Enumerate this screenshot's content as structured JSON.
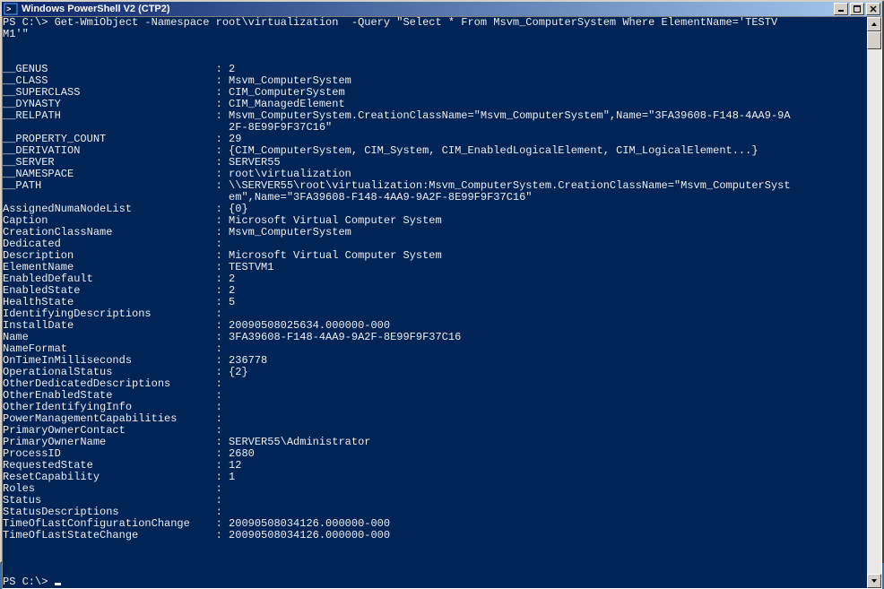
{
  "window": {
    "title": "Windows PowerShell V2 (CTP2)"
  },
  "console": {
    "prompt1": "PS C:\\> ",
    "command": "Get-WmiObject -Namespace root\\virtualization  -Query \"Select * From Msvm_ComputerSystem Where ElementName='TESTV",
    "command_line2": "M1'\"",
    "rows": [
      {
        "k": "__GENUS",
        "v": "2"
      },
      {
        "k": "__CLASS",
        "v": "Msvm_ComputerSystem"
      },
      {
        "k": "__SUPERCLASS",
        "v": "CIM_ComputerSystem"
      },
      {
        "k": "__DYNASTY",
        "v": "CIM_ManagedElement"
      },
      {
        "k": "__RELPATH",
        "v": "Msvm_ComputerSystem.CreationClassName=\"Msvm_ComputerSystem\",Name=\"3FA39608-F148-4AA9-9A"
      },
      {
        "k": "",
        "v": "2F-8E99F9F37C16\""
      },
      {
        "k": "__PROPERTY_COUNT",
        "v": "29"
      },
      {
        "k": "__DERIVATION",
        "v": "{CIM_ComputerSystem, CIM_System, CIM_EnabledLogicalElement, CIM_LogicalElement...}"
      },
      {
        "k": "__SERVER",
        "v": "SERVER55"
      },
      {
        "k": "__NAMESPACE",
        "v": "root\\virtualization"
      },
      {
        "k": "__PATH",
        "v": "\\\\SERVER55\\root\\virtualization:Msvm_ComputerSystem.CreationClassName=\"Msvm_ComputerSyst"
      },
      {
        "k": "",
        "v": "em\",Name=\"3FA39608-F148-4AA9-9A2F-8E99F9F37C16\""
      },
      {
        "k": "AssignedNumaNodeList",
        "v": "{0}"
      },
      {
        "k": "Caption",
        "v": "Microsoft Virtual Computer System"
      },
      {
        "k": "CreationClassName",
        "v": "Msvm_ComputerSystem"
      },
      {
        "k": "Dedicated",
        "v": ""
      },
      {
        "k": "Description",
        "v": "Microsoft Virtual Computer System"
      },
      {
        "k": "ElementName",
        "v": "TESTVM1"
      },
      {
        "k": "EnabledDefault",
        "v": "2"
      },
      {
        "k": "EnabledState",
        "v": "2"
      },
      {
        "k": "HealthState",
        "v": "5"
      },
      {
        "k": "IdentifyingDescriptions",
        "v": ""
      },
      {
        "k": "InstallDate",
        "v": "20090508025634.000000-000"
      },
      {
        "k": "Name",
        "v": "3FA39608-F148-4AA9-9A2F-8E99F9F37C16"
      },
      {
        "k": "NameFormat",
        "v": ""
      },
      {
        "k": "OnTimeInMilliseconds",
        "v": "236778"
      },
      {
        "k": "OperationalStatus",
        "v": "{2}"
      },
      {
        "k": "OtherDedicatedDescriptions",
        "v": ""
      },
      {
        "k": "OtherEnabledState",
        "v": ""
      },
      {
        "k": "OtherIdentifyingInfo",
        "v": ""
      },
      {
        "k": "PowerManagementCapabilities",
        "v": ""
      },
      {
        "k": "PrimaryOwnerContact",
        "v": ""
      },
      {
        "k": "PrimaryOwnerName",
        "v": "SERVER55\\Administrator"
      },
      {
        "k": "ProcessID",
        "v": "2680"
      },
      {
        "k": "RequestedState",
        "v": "12"
      },
      {
        "k": "ResetCapability",
        "v": "1"
      },
      {
        "k": "Roles",
        "v": ""
      },
      {
        "k": "Status",
        "v": ""
      },
      {
        "k": "StatusDescriptions",
        "v": ""
      },
      {
        "k": "TimeOfLastConfigurationChange",
        "v": "20090508034126.000000-000"
      },
      {
        "k": "TimeOfLastStateChange",
        "v": "20090508034126.000000-000"
      }
    ],
    "prompt2": "PS C:\\> "
  }
}
